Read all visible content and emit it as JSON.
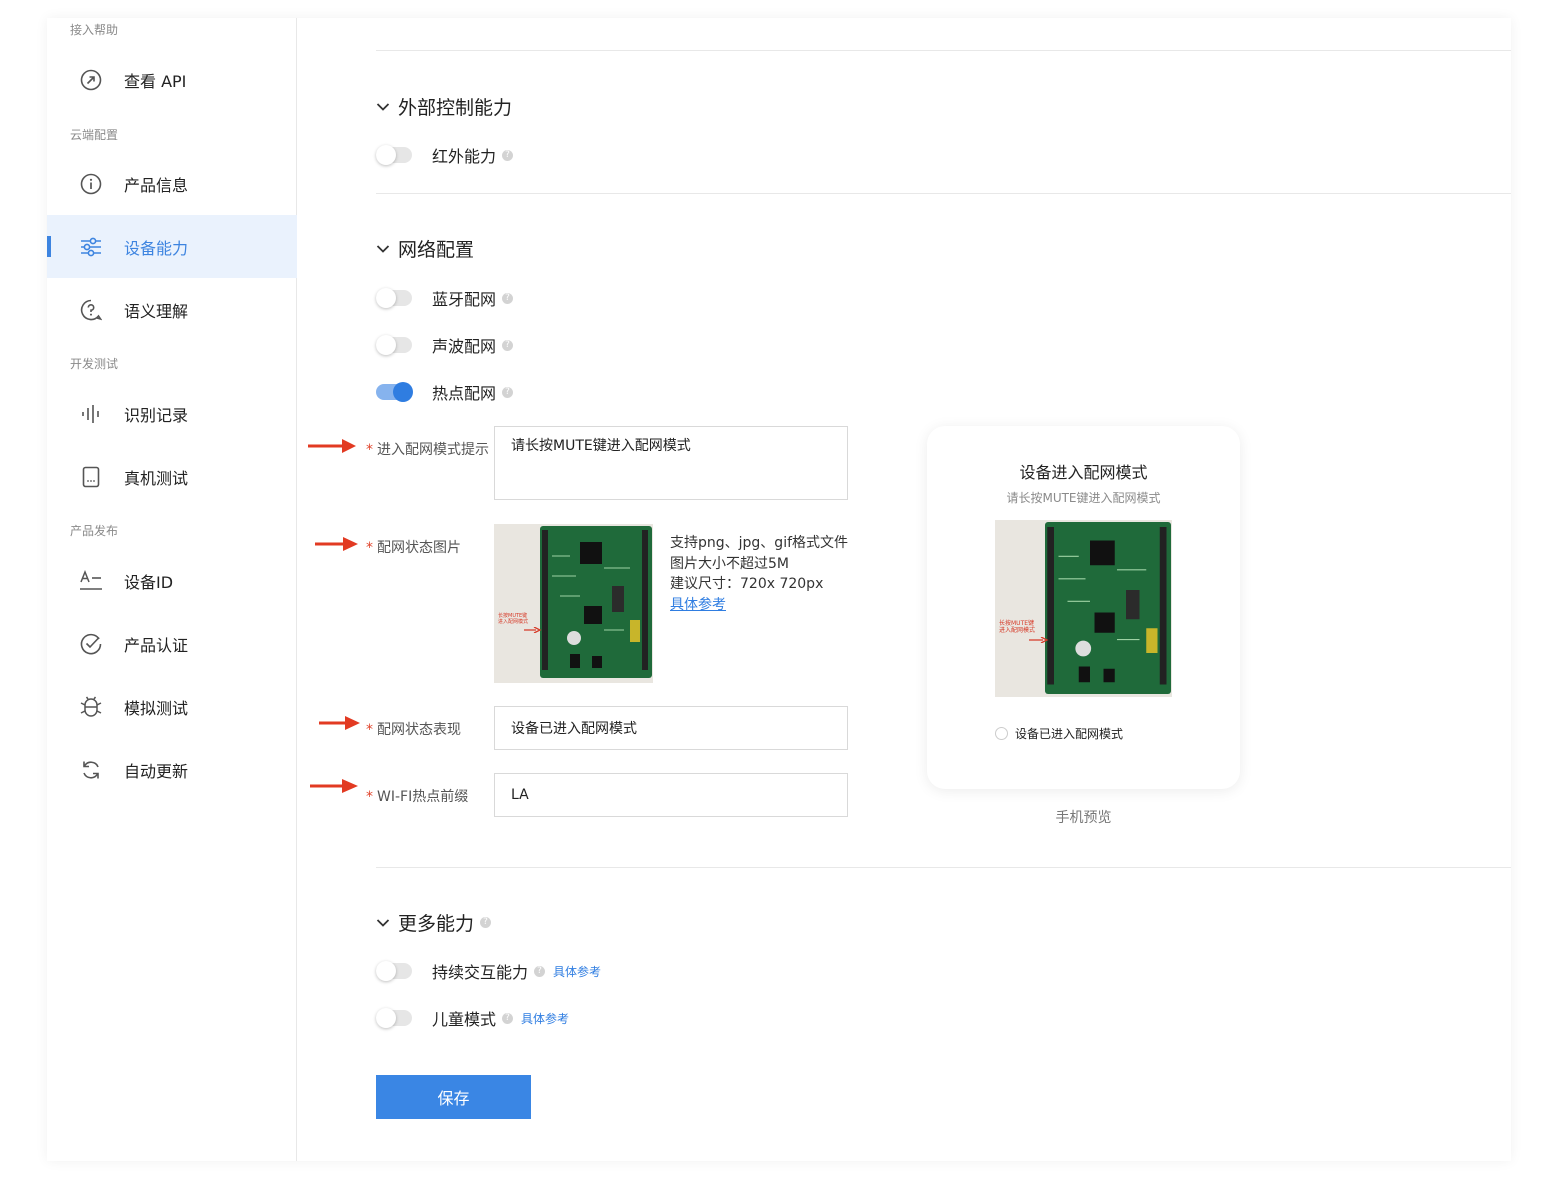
{
  "sidebar": {
    "groups": {
      "help": "接入帮助",
      "cloud": "云端配置",
      "dev": "开发测试",
      "publish": "产品发布"
    },
    "items": {
      "api": "查看 API",
      "product_info": "产品信息",
      "device_capability": "设备能力",
      "semantic": "语义理解",
      "recognition_log": "识别记录",
      "real_device_test": "真机测试",
      "device_id": "设备ID",
      "certification": "产品认证",
      "simulation_test": "模拟测试",
      "auto_update": "自动更新"
    },
    "active_item": "设备能力",
    "accent_color": "#3d84e0"
  },
  "sections": {
    "external": {
      "title": "外部控制能力",
      "infrared": {
        "label": "红外能力",
        "enabled": false
      }
    },
    "network": {
      "title": "网络配置",
      "bluetooth": {
        "label": "蓝牙配网",
        "enabled": false
      },
      "sonic": {
        "label": "声波配网",
        "enabled": false
      },
      "hotspot": {
        "label": "热点配网",
        "enabled": true
      }
    },
    "more": {
      "title": "更多能力",
      "continuous": {
        "label": "持续交互能力",
        "enabled": false,
        "link": "具体参考"
      },
      "kids": {
        "label": "儿童模式",
        "enabled": false,
        "link": "具体参考"
      }
    }
  },
  "form": {
    "prompt": {
      "label": "进入配网模式提示",
      "value": "请长按MUTE键进入配网模式"
    },
    "image": {
      "label": "配网状态图片",
      "tips": [
        "支持png、jpg、gif格式文件",
        "图片大小不超过5M",
        "建议尺寸：720x 720px"
      ],
      "link": "具体参考",
      "board_caption": [
        "长按MUTE键",
        "进入配网模式"
      ]
    },
    "status": {
      "label": "配网状态表现",
      "value": "设备已进入配网模式"
    },
    "wifi_prefix": {
      "label": "WI-FI热点前缀",
      "value": "LA"
    },
    "required_mark": "*"
  },
  "preview": {
    "title": "设备进入配网模式",
    "subtitle": "请长按MUTE键进入配网模式",
    "option": "设备已进入配网模式",
    "caption": "手机预览"
  },
  "save_label": "保存",
  "icons": {
    "help": "?"
  }
}
